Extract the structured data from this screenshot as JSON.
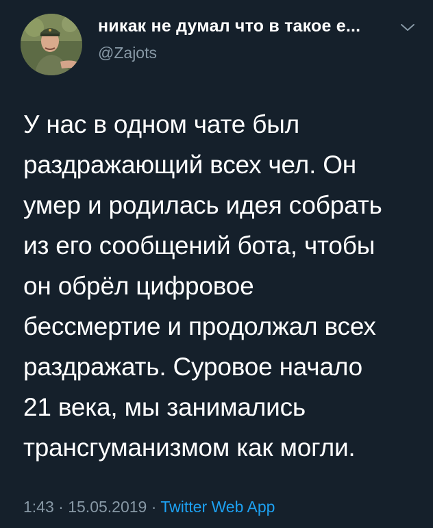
{
  "author": {
    "name": "никак не думал что в такое е...",
    "handle": "@Zajots"
  },
  "tweet": {
    "text": "У нас в одном чате был\nраздражающий всех чел. Он\nумер и родилась идея собрать\nиз его сообщений бота, чтобы\nон обрёл цифровое\nбессмертие и продолжал всех\nраздражать. Суровое начало\n21 века, мы занимались\nтрансгуманизмом как могли."
  },
  "meta": {
    "time": "1:43",
    "separator": "·",
    "date": "15.05.2019",
    "source": "Twitter Web App"
  },
  "icons": {
    "menu": "chevron-down-icon"
  },
  "colors": {
    "background": "#15202b",
    "text": "#ffffff",
    "secondary": "#8899a6",
    "accent": "#1da1f2"
  }
}
